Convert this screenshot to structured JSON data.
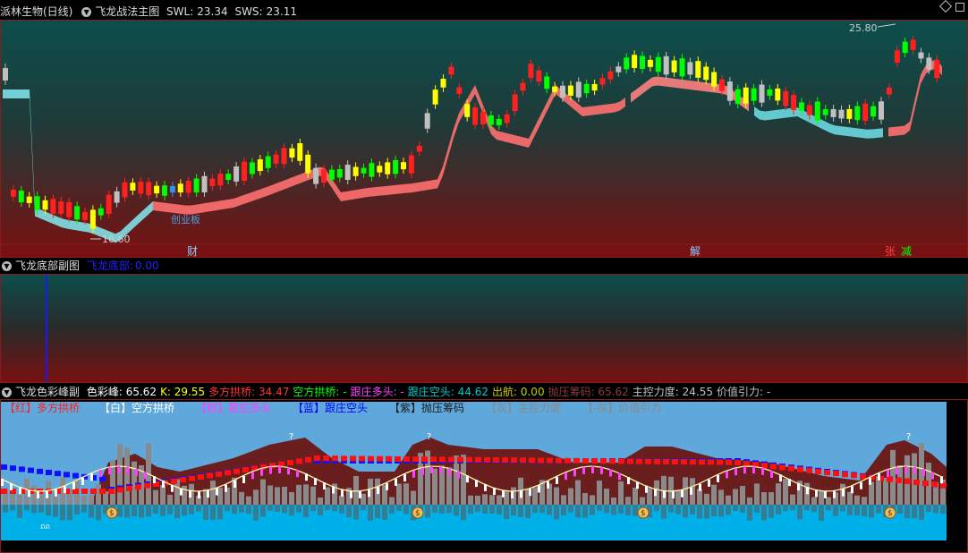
{
  "main": {
    "stock_name": "派林生物(日线)",
    "indicator_title": "飞龙战法主图",
    "swl_label": "SWL:",
    "swl_value": "23.34",
    "sws_label": "SWS:",
    "sws_value": "23.11",
    "high_marker": "25.80",
    "low_marker": "16.60",
    "annotation": "创业板",
    "date_markers": [
      "财",
      "解",
      "张",
      "减"
    ]
  },
  "sub1": {
    "title": "飞龙底部副图",
    "value_label": "飞龙底部:",
    "value": "0.00"
  },
  "sub2": {
    "title": "飞龙色彩峰副",
    "items": [
      {
        "label": "色彩峰:",
        "value": "65.62",
        "color": "#ffffff"
      },
      {
        "label": "K:",
        "value": "29.55",
        "color": "#ffff00"
      },
      {
        "label": "多方拱桥:",
        "value": "34.47",
        "color": "#ff3030"
      },
      {
        "label": "空方拱桥:",
        "value": "-",
        "color": "#00ff00"
      },
      {
        "label": "跟庄多头:",
        "value": "-",
        "color": "#ff40ff"
      },
      {
        "label": "跟庄空头:",
        "value": "44.62",
        "color": "#00c8c8"
      },
      {
        "label": "出航:",
        "value": "0.00",
        "color": "#c8c800"
      },
      {
        "label": "抛压筹码:",
        "value": "65.62",
        "color": "#8b3a3a"
      },
      {
        "label": "主控力度:",
        "value": "24.55",
        "color": "#c0c0c0"
      },
      {
        "label": "价值引力:",
        "value": "-",
        "color": "#c0c0c0"
      }
    ],
    "legend": [
      {
        "tag": "【红】",
        "text": "多方拱桥",
        "color": "#ff2020"
      },
      {
        "tag": "【白】",
        "text": "空方拱桥",
        "color": "#ffffff"
      },
      {
        "tag": "【粉】",
        "text": "跟庄多头",
        "color": "#ff40ff"
      },
      {
        "tag": "【蓝】",
        "text": "跟庄空头",
        "color": "#0000ff"
      },
      {
        "tag": "【紫】",
        "text": "抛压筹码",
        "color": "#1a1a1a"
      },
      {
        "tag": "【灰】",
        "text": "主控力度",
        "color": "#888888"
      },
      {
        "tag": "【-灰】",
        "text": "价值引力",
        "color": "#888888"
      }
    ],
    "question_mark": "?",
    "dollar_symbol": "$"
  },
  "colors": {
    "panel_border": "#8b1a1a",
    "up_candle": "#ff2020",
    "down_candle": "#00ff00",
    "yellow_candle": "#ffff00",
    "gray_candle": "#c0c0c0",
    "blue_candle": "#3a8ee6"
  }
}
